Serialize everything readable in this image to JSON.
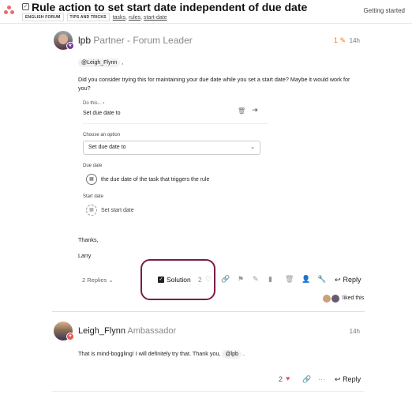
{
  "header": {
    "title": "Rule action to set start date independent of due date",
    "categories": [
      "ENGLISH FORUM",
      "TIPS AND TRICKS"
    ],
    "tags": [
      "tasks",
      "rules",
      "start-date"
    ],
    "getting_started": "Getting started"
  },
  "post1": {
    "username": "lpb",
    "role": "Partner - Forum Leader",
    "edit_count": "1",
    "time": "14h",
    "mention": "@Leigh_Flynn",
    "mention_suffix": ",",
    "body": "Did you consider trying this for maintaining your due date while you set a start date? Maybe it would work for you?",
    "screenshot": {
      "do_this": "Do this...",
      "action": "Set due date to",
      "choose_label": "Choose an option",
      "select_value": "Set due date to",
      "due_label": "Due date",
      "due_value": "the due date of the task that triggers the rule",
      "start_label": "Start date",
      "start_value": "Set start date"
    },
    "thanks": "Thanks,",
    "signature": "Larry",
    "replies_label": "2 Replies",
    "solution_label": "Solution",
    "like_count": "2",
    "reply_label": "Reply",
    "liked_text": "liked this"
  },
  "post2": {
    "username": "Leigh_Flynn",
    "role": "Ambassador",
    "time": "14h",
    "body_prefix": "That is mind-boggling! I will definitely try that. Thank you,",
    "mention": "@lpb",
    "body_suffix": ".",
    "like_count": "2",
    "reply_label": "Reply"
  },
  "colors": {
    "solution_highlight": "#7b1c4a",
    "edit_orange": "#e67e22",
    "heart_red": "#e45b5b",
    "logo": "#f06a6a"
  }
}
